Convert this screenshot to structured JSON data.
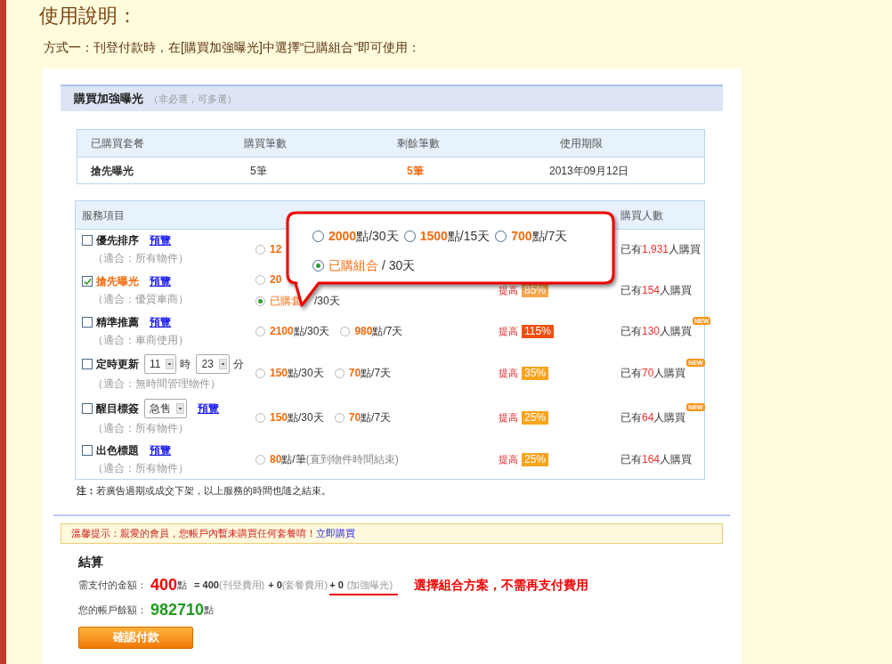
{
  "heading": "使用說明：",
  "instruction": "方式一：刊登付款時，在[購買加強曝光]中選擇“已購組合”即可使用：",
  "section": {
    "title": "購買加強曝光",
    "hint": "（非必選，可多選）"
  },
  "packages": {
    "columns": [
      "已購買套餐",
      "購買筆數",
      "剩餘筆數",
      "使用期限"
    ],
    "rows": [
      {
        "name": "搶先曝光",
        "bought": "5筆",
        "remaining": "5筆",
        "expiry": "2013年09月12日"
      }
    ]
  },
  "services": {
    "header": {
      "service_item": "服務項目",
      "buyer_count": "購買人數"
    },
    "rows": [
      {
        "name": "優先排序",
        "checked": false,
        "preview": "預覽",
        "scope": "（適合：所有物件）",
        "options": [
          {
            "kind": "points",
            "selected": false,
            "price": "12"
          }
        ],
        "count_prefix": "已有",
        "count": "1,931",
        "count_suffix": "人購買"
      },
      {
        "name": "搶先曝光",
        "checked": true,
        "preview": "預覽",
        "scope": "（適合：優質車商）",
        "options": [
          {
            "kind": "points",
            "selected": false,
            "price": "20"
          },
          {
            "kind": "package",
            "selected": true,
            "label": "已購套",
            "unit": "/30天"
          }
        ],
        "boost_label": "提高",
        "boost": "85%",
        "color": "#f7a64a",
        "count_prefix": "已有",
        "count": "154",
        "count_suffix": "人購買"
      },
      {
        "name": "精準推薦",
        "checked": false,
        "preview": "預覽",
        "scope": "（適合：車商使用）",
        "options": [
          {
            "kind": "points",
            "selected": false,
            "price": "2100",
            "unit": "點/30天"
          },
          {
            "kind": "points",
            "selected": false,
            "price": "980",
            "unit": "點/7天"
          }
        ],
        "boost_label": "提高",
        "boost": "115%",
        "color": "#f04e0e",
        "count_prefix": "已有",
        "count": "130",
        "count_suffix": "人購買",
        "badge": "NEW"
      },
      {
        "name": "定時更新",
        "checked": false,
        "controls": [
          {
            "kind": "select",
            "value": "11"
          },
          {
            "kind": "text",
            "text": "時"
          },
          {
            "kind": "select",
            "value": "23"
          },
          {
            "kind": "text",
            "text": "分"
          }
        ],
        "scope": "（適合：無時間管理物件）",
        "options": [
          {
            "kind": "points",
            "selected": false,
            "price": "150",
            "unit": "點/30天"
          },
          {
            "kind": "points",
            "selected": false,
            "price": "70",
            "unit": "點/7天"
          }
        ],
        "boost_label": "提高",
        "boost": "35%",
        "color": "#f8a31c",
        "count_prefix": "已有",
        "count": "70",
        "count_suffix": "人購買",
        "badge": "NEW"
      },
      {
        "name": "醒目標簽",
        "checked": false,
        "controls": [
          {
            "kind": "select",
            "value": "急售"
          }
        ],
        "preview": "預覽",
        "scope": "（適合：所有物件）",
        "options": [
          {
            "kind": "points",
            "selected": false,
            "price": "150",
            "unit": "點/30天"
          },
          {
            "kind": "points",
            "selected": false,
            "price": "70",
            "unit": "點/7天"
          }
        ],
        "boost_label": "提高",
        "boost": "25%",
        "color": "#f8a31c",
        "count_prefix": "已有",
        "count": "64",
        "count_suffix": "人購買",
        "badge": "NEW"
      },
      {
        "name": "出色標題",
        "checked": false,
        "preview": "預覽",
        "scope": "（適合：所有物件）",
        "options": [
          {
            "kind": "points",
            "selected": false,
            "price": "80",
            "unit": "點/筆",
            "note": "(直到物件時間結束)"
          }
        ],
        "boost_label": "提高",
        "boost": "25%",
        "color": "#f8a31c",
        "count_prefix": "已有",
        "count": "164",
        "count_suffix": "人購買"
      }
    ]
  },
  "callout": {
    "options": [
      {
        "kind": "points",
        "selected": false,
        "price": "2000",
        "unit": "點/30天"
      },
      {
        "kind": "points",
        "selected": false,
        "price": "1500",
        "unit": "點/15天"
      },
      {
        "kind": "points",
        "selected": false,
        "price": "700",
        "unit": "點/7天"
      },
      {
        "kind": "package",
        "selected": true,
        "label": "已購組合",
        "unit": "/ 30天"
      }
    ]
  },
  "note": "**注：**若廣告過期或成交下架，以上服務的時間也隨之結束。",
  "notice": {
    "text": "溫馨提示：親愛的會員，您帳戶內暫未購買任何套餐唷！",
    "link": "立即購買"
  },
  "settlement": {
    "title": "結算",
    "payable": {
      "label": "需支付的金額：",
      "amount": "400",
      "unit": "點",
      "parts": [
        {
          "kind": "value",
          "text": "= 400"
        },
        {
          "kind": "note",
          "text": "(刊登費用)"
        },
        {
          "kind": "value",
          "text": "+ 0"
        },
        {
          "kind": "note",
          "text": "(套餐費用)"
        }
      ],
      "highlight": [
        {
          "kind": "value",
          "text": "+ 0"
        },
        {
          "kind": "note",
          "text": "(加強曝光)"
        }
      ]
    },
    "balance": {
      "label": "您的帳戶餘額：",
      "amount": "982710",
      "unit": "點"
    },
    "button": "確認付款"
  },
  "annotation": "選擇組合方案，不需再支付費用"
}
